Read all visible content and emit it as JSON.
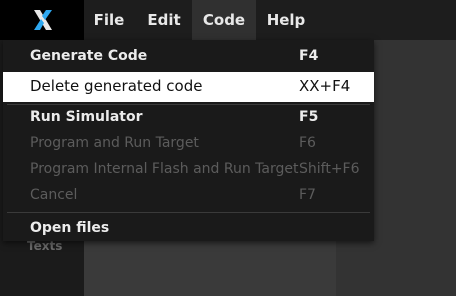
{
  "menubar": {
    "items": [
      {
        "label": "File"
      },
      {
        "label": "Edit"
      },
      {
        "label": "Code"
      },
      {
        "label": "Help"
      }
    ]
  },
  "background": {
    "left_panel_text": "Texts"
  },
  "code_menu": {
    "items": [
      {
        "label": "Generate Code",
        "shortcut": "F4",
        "enabled": true
      },
      {
        "label": "Delete generated code",
        "shortcut": "XX+F4",
        "enabled": true,
        "highlighted": true
      },
      {
        "label": "Run Simulator",
        "shortcut": "F5",
        "enabled": true
      },
      {
        "label": "Program and Run Target",
        "shortcut": "F6",
        "enabled": false
      },
      {
        "label": "Program Internal Flash and Run Target",
        "shortcut": "Shift+F6",
        "enabled": false
      },
      {
        "label": "Cancel",
        "shortcut": "F7",
        "enabled": false
      },
      {
        "label": "Open files",
        "shortcut": "",
        "enabled": true
      }
    ]
  },
  "colors": {
    "menubar_bg": "#1d1d1d",
    "logo_accent": "#2ea8f0",
    "highlight_bg": "#ffffff",
    "disabled_text": "#5c5c5c"
  }
}
